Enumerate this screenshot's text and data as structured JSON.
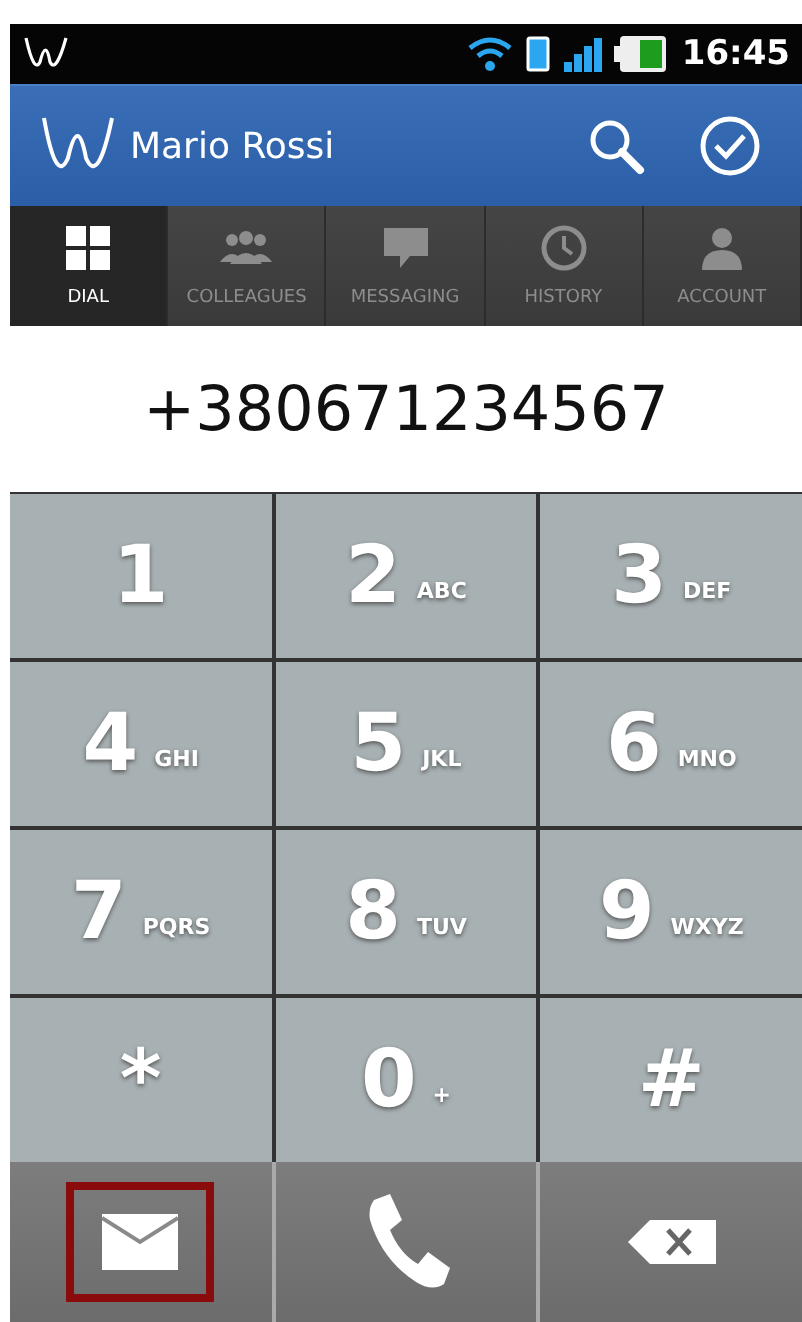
{
  "status_bar": {
    "time": "16:45"
  },
  "action_bar": {
    "title": "Mario Rossi"
  },
  "tabs": [
    {
      "label": "DIAL",
      "kind": "grid",
      "selected": true
    },
    {
      "label": "COLLEAGUES",
      "kind": "people",
      "selected": false
    },
    {
      "label": "MESSAGING",
      "kind": "bubble",
      "selected": false
    },
    {
      "label": "HISTORY",
      "kind": "clock",
      "selected": false
    },
    {
      "label": "ACCOUNT",
      "kind": "person",
      "selected": false
    }
  ],
  "number": "+380671234567",
  "keys": [
    {
      "digit": "1"
    },
    {
      "digit": "2",
      "letters": "ABC"
    },
    {
      "digit": "3",
      "letters": "DEF"
    },
    {
      "digit": "4",
      "letters": "GHI"
    },
    {
      "digit": "5",
      "letters": "JKL"
    },
    {
      "digit": "6",
      "letters": "MNO"
    },
    {
      "digit": "7",
      "letters": "PQRS"
    },
    {
      "digit": "8",
      "letters": "TUV"
    },
    {
      "digit": "9",
      "letters": "WXYZ"
    },
    {
      "digit": "*"
    },
    {
      "digit": "0",
      "letters": "+"
    },
    {
      "digit": "#"
    }
  ],
  "actions": [
    {
      "kind": "message",
      "selected": true
    },
    {
      "kind": "call",
      "selected": false
    },
    {
      "kind": "delete",
      "selected": false
    }
  ]
}
